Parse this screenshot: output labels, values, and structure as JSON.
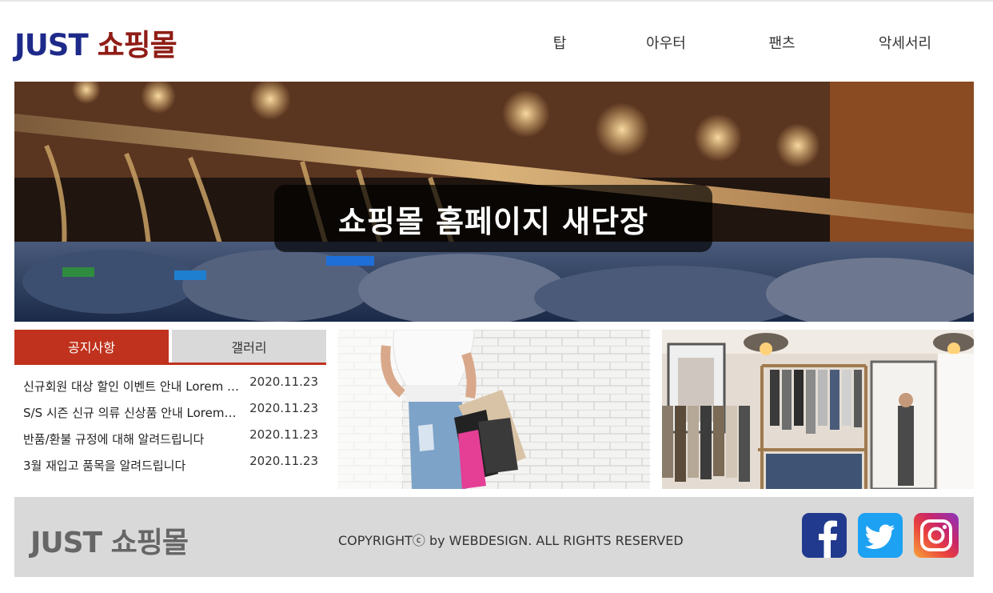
{
  "header": {
    "logo_part1": "JUST",
    "logo_part2": "쇼핑몰",
    "nav": [
      {
        "label": "탑"
      },
      {
        "label": "아우터"
      },
      {
        "label": "팬츠"
      },
      {
        "label": "악세서리"
      }
    ]
  },
  "hero": {
    "caption": "쇼핑몰 홈페이지 새단장"
  },
  "board": {
    "tabs": [
      {
        "label": "공지사항",
        "active": true
      },
      {
        "label": "갤러리",
        "active": false
      }
    ],
    "notices": [
      {
        "title": "신규회원 대상 할인 이벤트 안내 Lorem ipsum",
        "date": "2020.11.23"
      },
      {
        "title": "S/S 시즌 신규 의류 신상품 안내 Lorem ipsum",
        "date": "2020.11.23"
      },
      {
        "title": "반품/환불 규정에 대해 알려드립니다",
        "date": "2020.11.23"
      },
      {
        "title": "3월 재입고 품목을 알려드립니다",
        "date": "2020.11.23"
      }
    ]
  },
  "footer": {
    "logo": "JUST 쇼핑몰",
    "copyright": "COPYRIGHTⓒ by WEBDESIGN. ALL RIGHTS RESERVED",
    "social": [
      {
        "icon": "facebook-icon",
        "color": "#213a8e"
      },
      {
        "icon": "twitter-icon",
        "color": "#1da1f2"
      },
      {
        "icon": "instagram-icon",
        "color": "#c8266b"
      }
    ]
  },
  "colors": {
    "logo_blue": "#1e2a8a",
    "logo_red": "#8f1d16",
    "accent": "#c0321d",
    "tab_inactive": "#d9d9d9",
    "footer_bg": "#d9d9d9"
  }
}
